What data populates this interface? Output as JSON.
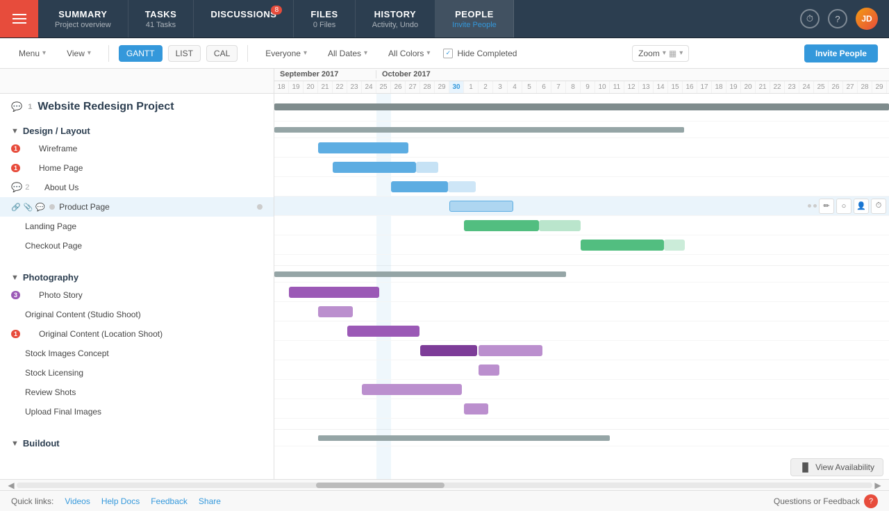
{
  "nav": {
    "tabs": [
      {
        "id": "summary",
        "title": "SUMMARY",
        "sub": "Project overview",
        "active": false
      },
      {
        "id": "tasks",
        "title": "TASKS",
        "sub": "41 Tasks",
        "active": false
      },
      {
        "id": "discussions",
        "title": "DISCUSSIONS",
        "sub": "",
        "badge": "8",
        "active": false
      },
      {
        "id": "files",
        "title": "FILES",
        "sub": "0 Files",
        "active": false
      },
      {
        "id": "history",
        "title": "HISTORY",
        "sub": "Activity, Undo",
        "active": false
      },
      {
        "id": "people",
        "title": "PEOPLE",
        "sub": "Invite People",
        "active": true
      }
    ]
  },
  "toolbar": {
    "menu_label": "Menu",
    "view_label": "View",
    "gantt_label": "GANTT",
    "list_label": "LIST",
    "cal_label": "CAL",
    "everyone_label": "Everyone",
    "all_dates_label": "All Dates",
    "all_colors_label": "All Colors",
    "hide_completed_label": "Hide Completed",
    "zoom_label": "Zoom",
    "invite_label": "Invite People"
  },
  "gantt": {
    "project_title": "Website Redesign Project",
    "comment_count": "1",
    "months": [
      {
        "label": "September 2017",
        "days": [
          18,
          19,
          20,
          21,
          22,
          23,
          24,
          25,
          26,
          27,
          28,
          29,
          30,
          1,
          2,
          3,
          4,
          5,
          6,
          7,
          8,
          9,
          10,
          11,
          12,
          13,
          14,
          15,
          16,
          17,
          18,
          19,
          20,
          21,
          22,
          23,
          24,
          25,
          26,
          27,
          28,
          29
        ]
      },
      {
        "label": "October 2017"
      }
    ],
    "sections": [
      {
        "id": "design",
        "label": "Design / Layout",
        "tasks": [
          {
            "name": "Wireframe",
            "comments": 1,
            "comment_color": "red"
          },
          {
            "name": "Home Page",
            "comments": 1,
            "comment_color": "red"
          },
          {
            "name": "About Us",
            "comments": 2,
            "comment_color": "gray"
          },
          {
            "name": "Product Page",
            "comments": 0,
            "active": true
          },
          {
            "name": "Landing Page",
            "comments": 0
          },
          {
            "name": "Checkout Page",
            "comments": 0
          }
        ]
      },
      {
        "id": "photography",
        "label": "Photography",
        "tasks": [
          {
            "name": "Photo Story",
            "comments": 3,
            "comment_color": "purple"
          },
          {
            "name": "Original Content (Studio Shoot)",
            "comments": 0
          },
          {
            "name": "Original Content (Location Shoot)",
            "comments": 1,
            "comment_color": "red"
          },
          {
            "name": "Stock Images Concept",
            "comments": 0
          },
          {
            "name": "Stock Licensing",
            "comments": 0
          },
          {
            "name": "Review Shots",
            "comments": 0
          },
          {
            "name": "Upload Final Images",
            "comments": 0
          }
        ]
      },
      {
        "id": "buildout",
        "label": "Buildout",
        "tasks": []
      }
    ]
  },
  "footer": {
    "quick_links_label": "Quick links:",
    "links": [
      "Videos",
      "Help Docs",
      "Feedback",
      "Share"
    ],
    "help_label": "Questions or Feedback",
    "view_availability_label": "View Availability"
  }
}
